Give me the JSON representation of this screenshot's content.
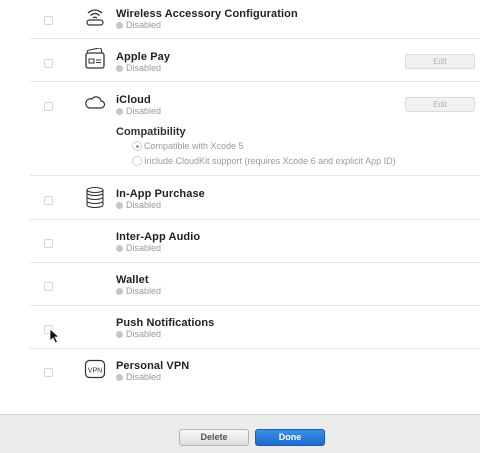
{
  "capabilities": [
    {
      "title": "Wireless Accessory Configuration",
      "status": "Disabled",
      "icon": "wireless-icon"
    },
    {
      "title": "Apple Pay",
      "status": "Disabled",
      "icon": "apple-pay-card-icon",
      "edit_label": "Edit"
    },
    {
      "title": "iCloud",
      "status": "Disabled",
      "icon": "icloud-icon",
      "edit_label": "Edit"
    },
    {
      "title": "In-App Purchase",
      "status": "Disabled",
      "icon": "coin-stack-icon"
    },
    {
      "title": "Inter-App Audio",
      "status": "Disabled"
    },
    {
      "title": "Wallet",
      "status": "Disabled"
    },
    {
      "title": "Push Notifications",
      "status": "Disabled"
    },
    {
      "title": "Personal VPN",
      "status": "Disabled",
      "icon": "vpn-icon",
      "icon_text": "VPN"
    }
  ],
  "icloud_compat": {
    "heading": "Compatibility",
    "options": [
      {
        "label": "Compatible with Xcode 5",
        "selected": true
      },
      {
        "label": "Include CloudKit support (requires Xcode 6 and explicit App ID)",
        "selected": false
      }
    ]
  },
  "footer": {
    "delete_label": "Delete",
    "done_label": "Done"
  },
  "colors": {
    "done_button": "#1c6bd0",
    "status_dot": "#c6c6c6"
  }
}
